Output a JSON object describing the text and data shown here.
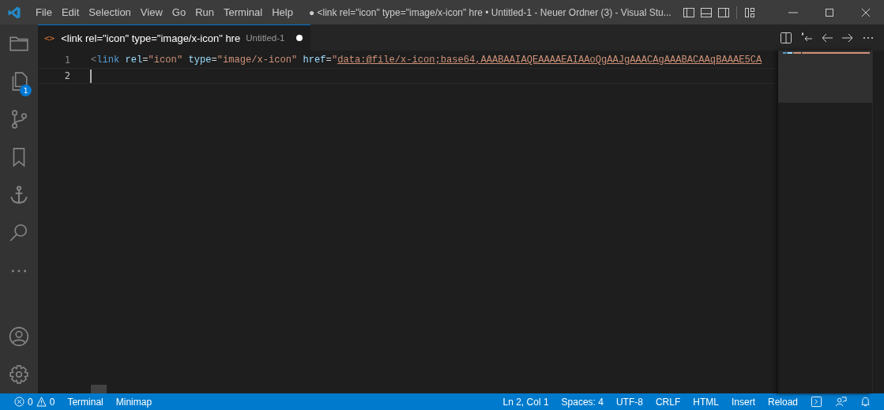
{
  "menu": [
    "File",
    "Edit",
    "Selection",
    "View",
    "Go",
    "Run",
    "Terminal",
    "Help"
  ],
  "window": {
    "title": "● <link rel=\"icon\" type=\"image/x-icon\" hre • Untitled-1 - Neuer Ordner (3) - Visual Stu..."
  },
  "activity_bar": [
    {
      "kind": "files"
    },
    {
      "kind": "copy",
      "badge": "1"
    },
    {
      "kind": "branch"
    },
    {
      "kind": "bookmark"
    },
    {
      "kind": "anchor"
    },
    {
      "kind": "search"
    },
    {
      "kind": "more"
    }
  ],
  "activity_bottom": [
    {
      "kind": "account"
    },
    {
      "kind": "gear"
    }
  ],
  "tabs": [
    {
      "label": "<link rel=\"icon\" type=\"image/x-icon\" hre",
      "description": "Untitled-1",
      "icon": "<>",
      "selected": true,
      "modified": true
    }
  ],
  "editor": {
    "lines": [
      {
        "number": "1",
        "current": false,
        "tokens": [
          {
            "kind": "punct",
            "text": "<"
          },
          {
            "kind": "tag",
            "text": "link"
          },
          {
            "kind": "attr",
            "text": " rel"
          },
          {
            "kind": "eq",
            "text": "="
          },
          {
            "kind": "str",
            "text": "\"icon\""
          },
          {
            "kind": "attr",
            "text": " type"
          },
          {
            "kind": "eq",
            "text": "="
          },
          {
            "kind": "str",
            "text": "\"image/x-icon\""
          },
          {
            "kind": "attr",
            "text": " href"
          },
          {
            "kind": "eq",
            "text": "="
          },
          {
            "kind": "str",
            "text": "\""
          },
          {
            "kind": "link",
            "text": "data:@file/x-icon;base64,AAABAAIAQEAAAAEAIAAoQgAAJgAAACAgAAABACAAqBAAAE5CA"
          }
        ]
      },
      {
        "number": "2",
        "current": true
      }
    ]
  },
  "status_bar": {
    "left": [
      {
        "kind": "problems",
        "errors": "0",
        "warnings": "0"
      },
      {
        "kind": "text",
        "text": "Terminal"
      },
      {
        "kind": "text",
        "text": "Minimap"
      }
    ],
    "right": [
      "Ln 2, Col 1",
      "Spaces: 4",
      "UTF-8",
      "CRLF",
      "HTML",
      "Insert",
      "Reload"
    ]
  }
}
